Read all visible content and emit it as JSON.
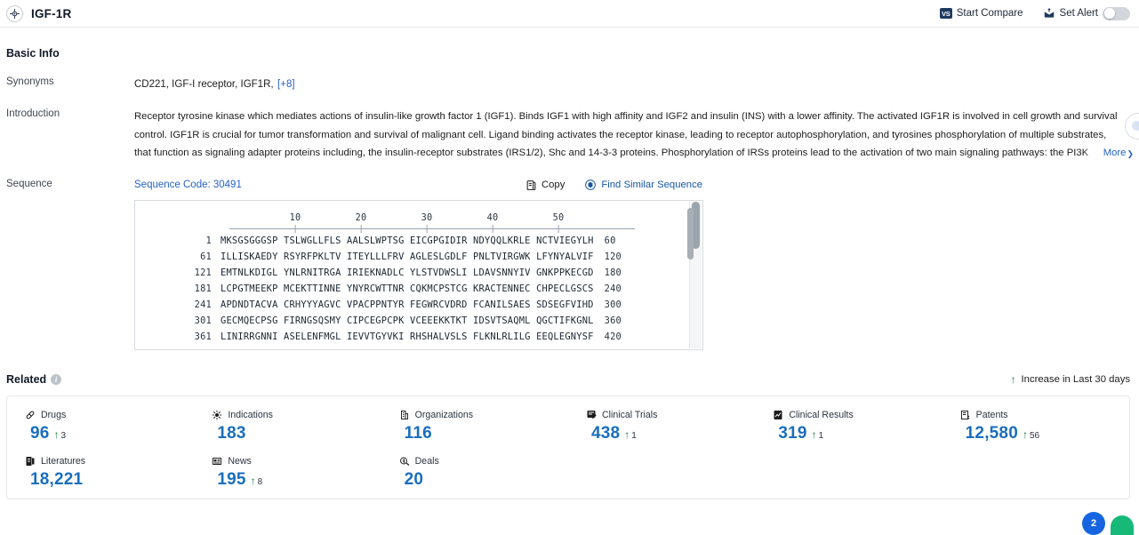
{
  "header": {
    "title": "IGF-1R",
    "target_icon": "target-icon",
    "start_compare": "Start Compare",
    "vs_badge": "VS",
    "set_alert": "Set Alert",
    "alert_toggle_state": "off"
  },
  "basic_info": {
    "section_title": "Basic Info",
    "synonyms_label": "Synonyms",
    "synonyms_value": "CD221,  IGF-I receptor,  IGF1R,",
    "synonyms_more": "[+8]",
    "introduction_label": "Introduction",
    "introduction_text": "Receptor tyrosine kinase which mediates actions of insulin-like growth factor 1 (IGF1). Binds IGF1 with high affinity and IGF2 and insulin (INS) with a lower affinity. The activated IGF1R is involved in cell growth and survival control. IGF1R is crucial for tumor transformation and survival of malignant cell. Ligand binding activates the receptor kinase, leading to receptor autophosphorylation, and tyrosines phosphorylation of multiple substrates, that function as signaling adapter proteins including, the insulin-receptor substrates (IRS1/2), Shc and 14-3-3 proteins. Phosphorylation of IRSs proteins lead to the activation of two main signaling pathways: the PI3K",
    "more_label": "More"
  },
  "sequence": {
    "label": "Sequence",
    "code_text": "Sequence Code: 30491",
    "copy_label": "Copy",
    "find_similar_label": "Find Similar Sequence",
    "ruler_ticks": [
      "10",
      "20",
      "30",
      "40",
      "50"
    ],
    "lines": [
      {
        "start": "1",
        "residues": "MKSGSGGGSP TSLWGLLFLS AALSLWPTSG EICGPGIDIR NDYQQLKRLE NCTVIEGYLH",
        "end": "60"
      },
      {
        "start": "61",
        "residues": "ILLISKAEDY RSYRFPKLTV ITEYLLLFRV AGLESLGDLF PNLTVIRGWK LFYNYALVIF",
        "end": "120"
      },
      {
        "start": "121",
        "residues": "EMTNLKDIGL YNLRNITRGA IRIEKNADLC YLSTVDWSLI LDAVSNNYIV GNKPPKECGD",
        "end": "180"
      },
      {
        "start": "181",
        "residues": "LCPGTMEEKP MCEKTTINNE YNYRCWTTNR CQKMCPSTCG KRACTENNEC CHPECLGSCS",
        "end": "240"
      },
      {
        "start": "241",
        "residues": "APDNDTACVA CRHYYYAGVC VPACPPNTYR FEGWRCVDRD FCANILSAES SDSEGFVIHD",
        "end": "300"
      },
      {
        "start": "301",
        "residues": "GECMQECPSG FIRNGSQSMY CIPCEGPCPK VCEEEKKTKT IDSVTSAQML QGCTIFKGNL",
        "end": "360"
      },
      {
        "start": "361",
        "residues": "LINIRRGNNI ASELENFMGL IEVVTGYVKI RHSHALVSLS FLKNLRLILG EEQLEGNYSF",
        "end": "420"
      }
    ]
  },
  "related": {
    "title": "Related",
    "legend": "Increase in Last 30 days",
    "stats": [
      {
        "label": "Drugs",
        "icon": "pill-icon",
        "value": "96",
        "delta": "3"
      },
      {
        "label": "Indications",
        "icon": "virus-icon",
        "value": "183",
        "delta": ""
      },
      {
        "label": "Organizations",
        "icon": "building-icon",
        "value": "116",
        "delta": ""
      },
      {
        "label": "Clinical Trials",
        "icon": "clinical-trial-icon",
        "value": "438",
        "delta": "1"
      },
      {
        "label": "Clinical Results",
        "icon": "clinical-result-icon",
        "value": "319",
        "delta": "1"
      },
      {
        "label": "Patents",
        "icon": "patent-icon",
        "value": "12,580",
        "delta": "56"
      },
      {
        "label": "Literatures",
        "icon": "literature-icon",
        "value": "18,221",
        "delta": ""
      },
      {
        "label": "News",
        "icon": "news-icon",
        "value": "195",
        "delta": "8"
      },
      {
        "label": "Deals",
        "icon": "deal-icon",
        "value": "20",
        "delta": ""
      }
    ]
  },
  "floating": {
    "chat_badge": "2"
  },
  "colors": {
    "link_blue": "#2563c9",
    "stat_blue": "#1a6ebd",
    "increase_green": "#1a7a3c",
    "vs_navy": "#1e3a5f"
  }
}
